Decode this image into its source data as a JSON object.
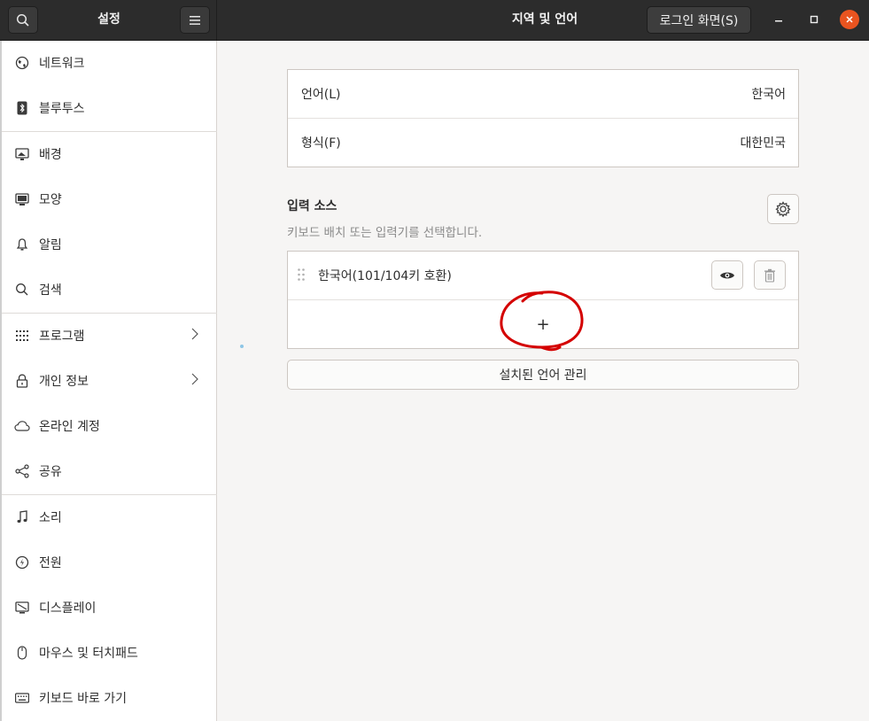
{
  "header": {
    "sidebar_title": "설정",
    "title": "지역 및 언어",
    "login_button": "로그인 화면(S)"
  },
  "sidebar": {
    "items": [
      {
        "label": "네트워크",
        "icon": "network-icon"
      },
      {
        "label": "블루투스",
        "icon": "bluetooth-icon"
      },
      {
        "label": "배경",
        "icon": "background-icon"
      },
      {
        "label": "모양",
        "icon": "appearance-icon"
      },
      {
        "label": "알림",
        "icon": "bell-icon"
      },
      {
        "label": "검색",
        "icon": "search-icon"
      },
      {
        "label": "프로그램",
        "icon": "apps-grid-icon"
      },
      {
        "label": "개인 정보",
        "icon": "lock-icon"
      },
      {
        "label": "온라인 계정",
        "icon": "cloud-icon"
      },
      {
        "label": "공유",
        "icon": "share-icon"
      },
      {
        "label": "소리",
        "icon": "music-note-icon"
      },
      {
        "label": "전원",
        "icon": "power-icon"
      },
      {
        "label": "디스플레이",
        "icon": "display-icon"
      },
      {
        "label": "마우스 및 터치패드",
        "icon": "mouse-icon"
      },
      {
        "label": "키보드 바로 가기",
        "icon": "keyboard-icon"
      }
    ]
  },
  "main": {
    "language": {
      "label": "언어(L)",
      "value": "한국어"
    },
    "formats": {
      "label": "형식(F)",
      "value": "대한민국"
    },
    "input_sources": {
      "title": "입력 소스",
      "description": "키보드 배치 또는 입력기를 선택합니다.",
      "items": [
        {
          "label": "한국어(101/104키 호환)"
        }
      ],
      "add_symbol": "+"
    },
    "manage_button": "설치된 언어 관리"
  },
  "colors": {
    "header_bg": "#2c2c2c",
    "close_button": "#e95420",
    "annotation_circle": "#d40000"
  }
}
